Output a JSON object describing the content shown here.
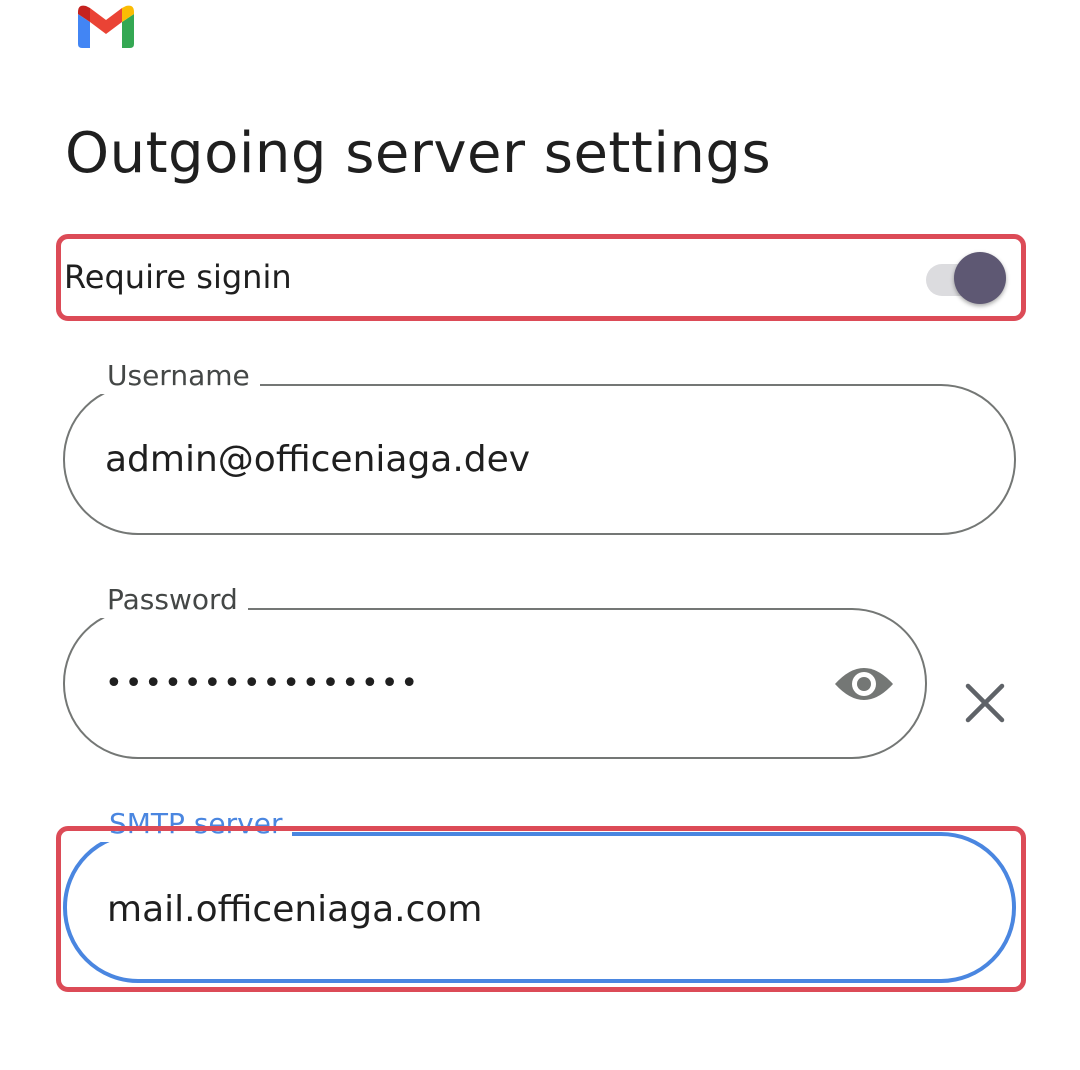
{
  "app": {
    "logo_icon": "gmail-logo-icon"
  },
  "page": {
    "title": "Outgoing server settings"
  },
  "signin": {
    "label": "Require signin",
    "enabled": true
  },
  "username": {
    "label": "Username",
    "value": "admin@officeniaga.dev"
  },
  "password": {
    "label": "Password",
    "value_masked": "••••••••••••••••",
    "reveal_icon": "eye-icon",
    "clear_icon": "close-icon"
  },
  "smtp": {
    "label": "SMTP server",
    "value": "mail.officeniaga.com"
  },
  "colors": {
    "accent": "#4a86e0",
    "highlight": "#dc4b57",
    "toggle_thumb": "#5e5873",
    "border": "#747775"
  }
}
